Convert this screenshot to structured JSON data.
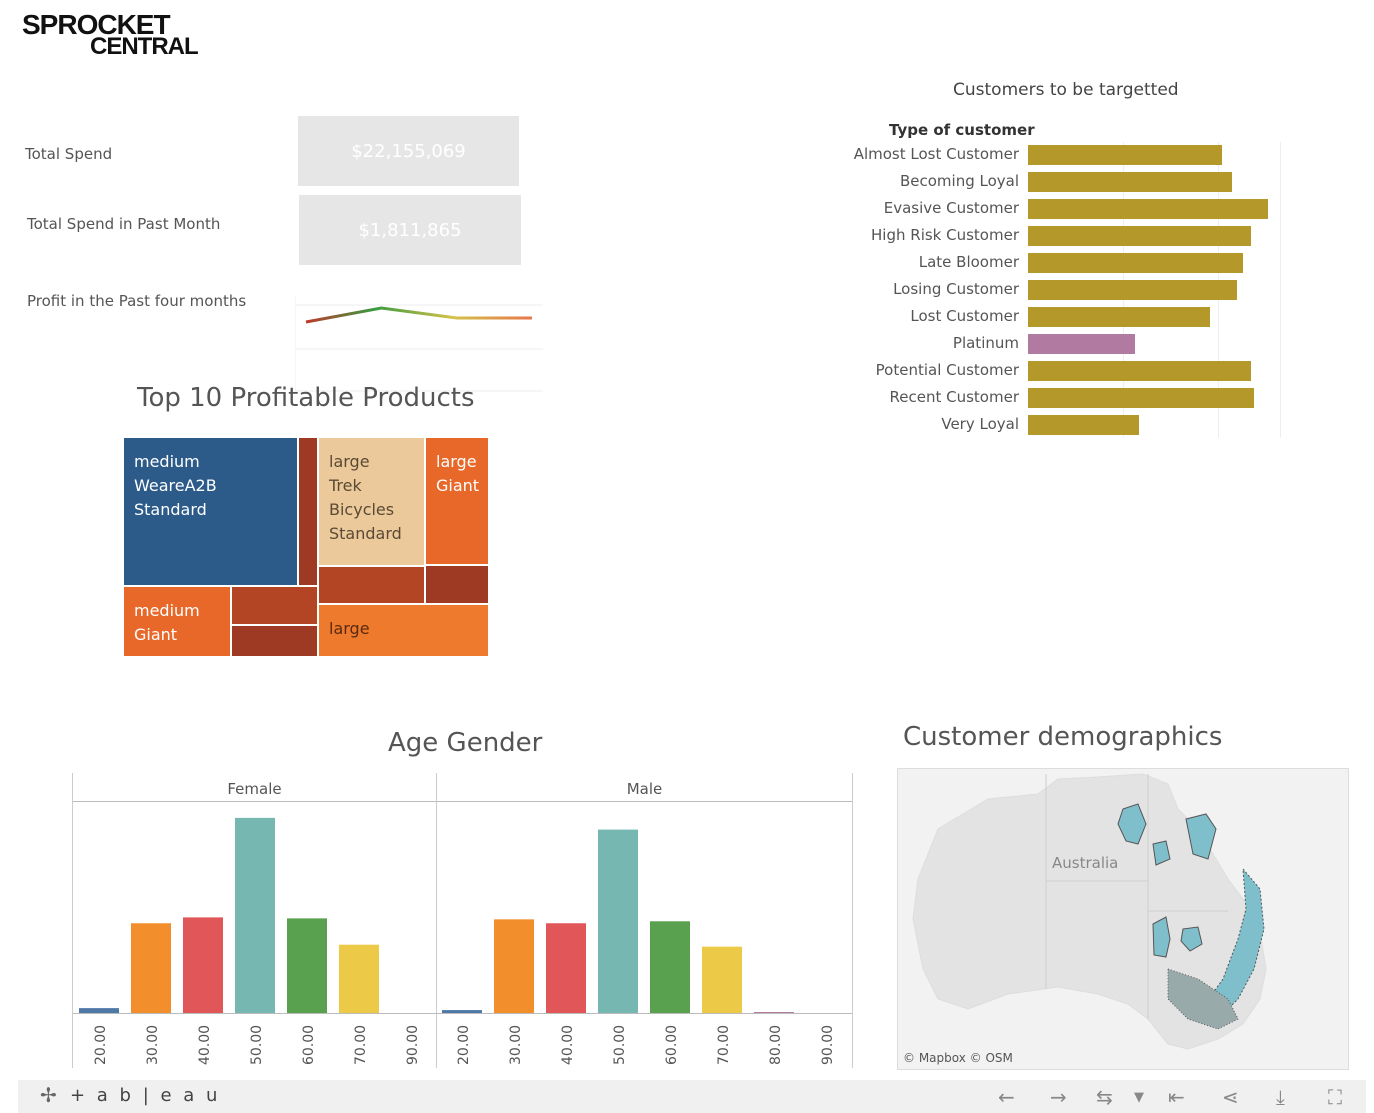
{
  "logo": {
    "line1": "SPROCKET",
    "line2": "CENTRAL"
  },
  "kpis": [
    {
      "label": "Total Spend",
      "value": "$22,155,069"
    },
    {
      "label": "Total Spend in Past Month",
      "value": "$1,811,865"
    }
  ],
  "profit": {
    "label": "Profit in the Past four months"
  },
  "treemap": {
    "title": "Top 10 Profitable Products",
    "tiles": [
      {
        "label": "medium\nWeareA2B\nStandard",
        "color": "#2c5b8a"
      },
      {
        "label": "large\nTrek\nBicycles\nStandard",
        "color": "#ecc99a"
      },
      {
        "label": "large\nGiant",
        "color": "#e8682a"
      },
      {
        "label": "medium\nGiant",
        "color": "#e8682a"
      },
      {
        "label": "large",
        "color": "#ed7a2d"
      }
    ]
  },
  "customers_chart": {
    "title": "Customers to be targetted",
    "header": "Type of customer"
  },
  "age_gender": {
    "title": "Age Gender",
    "panels": [
      "Female",
      "Male"
    ]
  },
  "map": {
    "title": "Customer demographics",
    "label": "Australia",
    "credits": "© Mapbox  © OSM"
  },
  "footer": {
    "brand": "+ a b | e a u"
  },
  "chart_data": [
    {
      "type": "line",
      "title": "Profit in the Past four months",
      "x": [
        1,
        2,
        3,
        4
      ],
      "values": [
        0.45,
        0.8,
        0.55,
        0.55
      ],
      "colors": [
        "#c0392b",
        "#3a9a40",
        "#d4c24a",
        "#e8764a"
      ]
    },
    {
      "type": "bar",
      "title": "Customers to be targetted",
      "ylabel": "Type of customer",
      "categories": [
        "Almost Lost Customer",
        "Becoming Loyal",
        "Evasive Customer",
        "High Risk Customer",
        "Late Bloomer",
        "Losing Customer",
        "Lost Customer",
        "Platinum",
        "Potential Customer",
        "Recent Customer",
        "Very Loyal"
      ],
      "values": [
        200,
        210,
        248,
        230,
        222,
        216,
        188,
        110,
        230,
        233,
        115
      ],
      "colors": [
        "#b5982a",
        "#b5982a",
        "#b5982a",
        "#b5982a",
        "#b5982a",
        "#b5982a",
        "#b5982a",
        "#b07aa1",
        "#b5982a",
        "#b5982a",
        "#b5982a"
      ],
      "xlim": [
        0,
        260
      ]
    },
    {
      "type": "bar",
      "title": "Age Gender",
      "series": [
        {
          "name": "Female",
          "categories": [
            "20.00",
            "30.00",
            "40.00",
            "50.00",
            "60.00",
            "70.00",
            "90.00"
          ],
          "values": [
            5,
            92,
            98,
            200,
            97,
            70,
            0
          ]
        },
        {
          "name": "Male",
          "categories": [
            "20.00",
            "30.00",
            "40.00",
            "50.00",
            "60.00",
            "70.00",
            "80.00",
            "90.00"
          ],
          "values": [
            3,
            96,
            92,
            188,
            94,
            68,
            1,
            0
          ]
        }
      ],
      "colors": {
        "20.00": "#4e79a7",
        "30.00": "#f28e2b",
        "40.00": "#e15759",
        "50.00": "#76b7b2",
        "60.00": "#59a14f",
        "70.00": "#edc948",
        "80.00": "#b07aa1",
        "90.00": "#ff9da7"
      },
      "ylim": [
        0,
        205
      ]
    }
  ]
}
